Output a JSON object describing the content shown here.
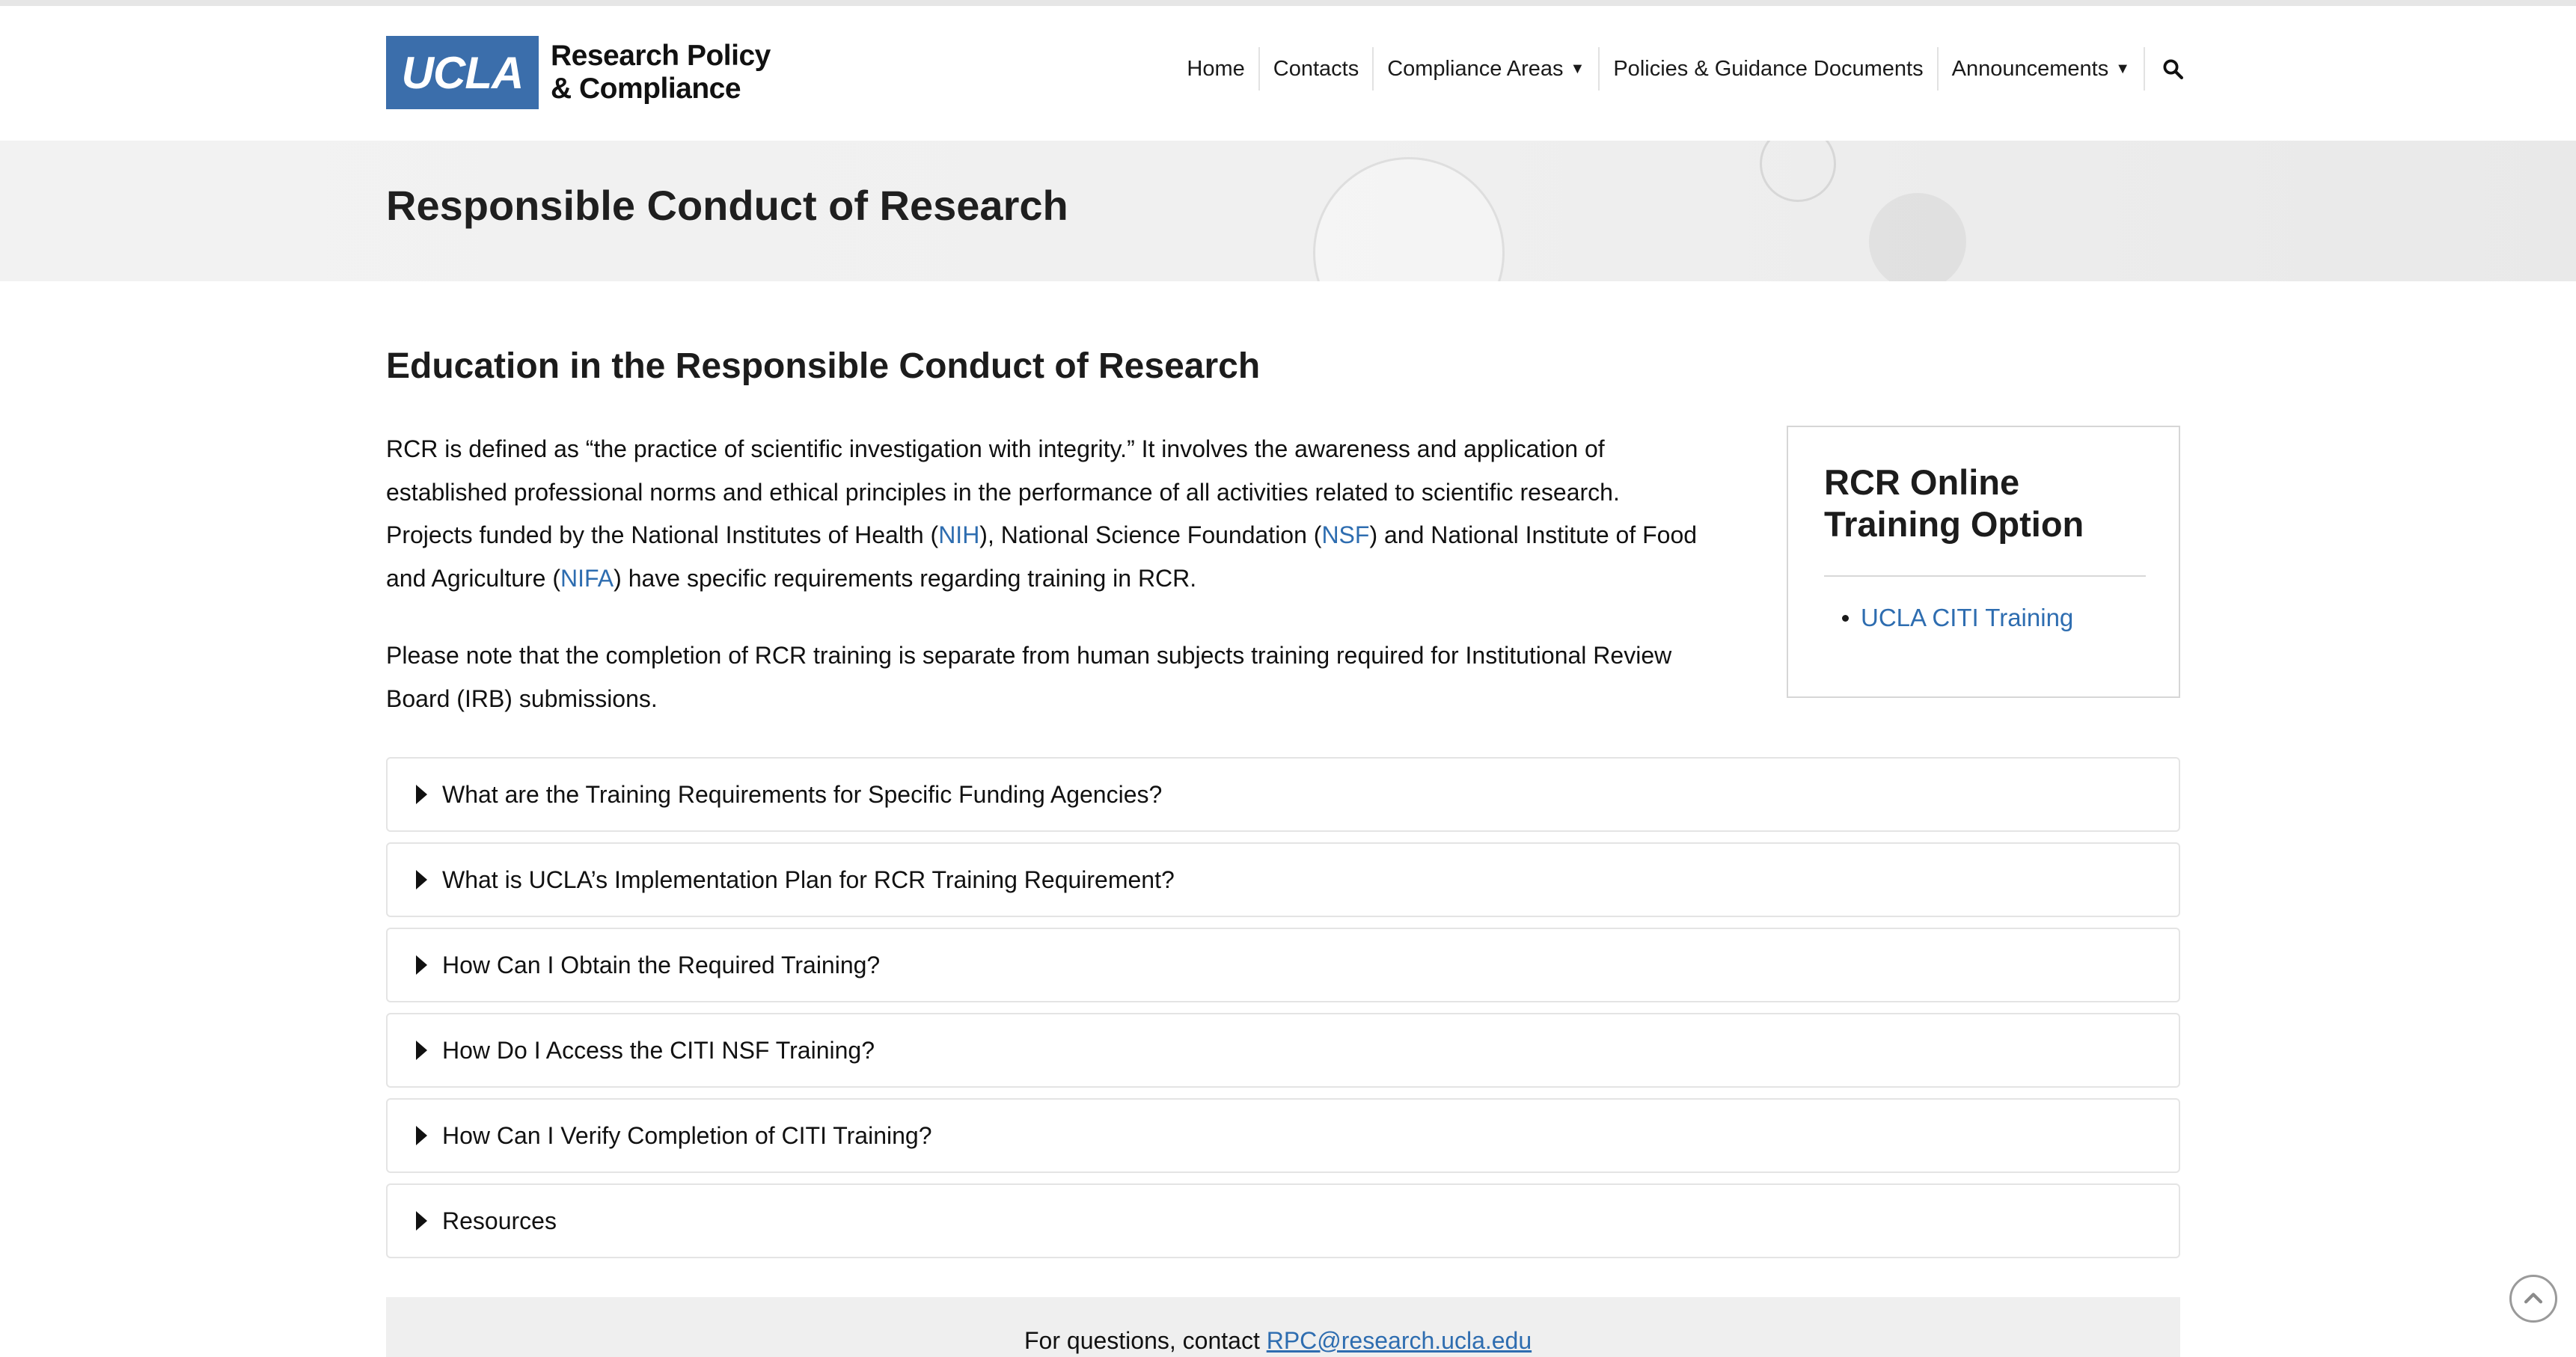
{
  "header": {
    "logo": {
      "mark": "UCLA",
      "line1": "Research Policy",
      "line2": "& Compliance"
    },
    "nav": [
      {
        "label": "Home"
      },
      {
        "label": "Contacts"
      },
      {
        "label": "Compliance Areas",
        "has_dropdown": true
      },
      {
        "label": "Policies & Guidance Documents"
      },
      {
        "label": "Announcements",
        "has_dropdown": true
      }
    ],
    "search_icon": "search-icon"
  },
  "hero": {
    "title": "Responsible Conduct of Research"
  },
  "main": {
    "section_title": "Education in the Responsible Conduct of Research",
    "para1": {
      "t1": "RCR is defined as “the practice of scientific investigation with integrity.” It involves the awareness and application of established professional norms and ethical principles in the performance of all activities related to scientific research. Projects funded by the National Institutes of Health (",
      "link_nih": "NIH",
      "t2": "), National Science Foundation (",
      "link_nsf": "NSF",
      "t3": ") and National Institute of Food and Agriculture (",
      "link_nifa": "NIFA",
      "t4": ") have specific requirements regarding training in RCR."
    },
    "para2": "Please note that the completion of RCR training is separate from human subjects training required for Institutional Review Board (IRB) submissions."
  },
  "sidebar": {
    "title": "RCR Online Training Option",
    "links": [
      {
        "label": "UCLA CITI Training"
      }
    ]
  },
  "accordion": [
    {
      "label": "What are the Training Requirements for Specific Funding Agencies?"
    },
    {
      "label": "What is UCLA’s Implementation Plan for RCR Training Requirement?"
    },
    {
      "label": "How Can I Obtain the Required Training?"
    },
    {
      "label": "How Do I Access the CITI NSF Training?"
    },
    {
      "label": "How Can I Verify Completion of CITI Training?"
    },
    {
      "label": "Resources"
    }
  ],
  "contact_bar": {
    "text": "For questions, contact ",
    "email": "RPC@research.ucla.edu"
  },
  "scroll_top_icon": "chevron-up-icon",
  "colors": {
    "brand": "#3b6eab",
    "link": "#2e6db0",
    "hero_bg": "#f0f0f0",
    "text": "#1a1a1a"
  }
}
